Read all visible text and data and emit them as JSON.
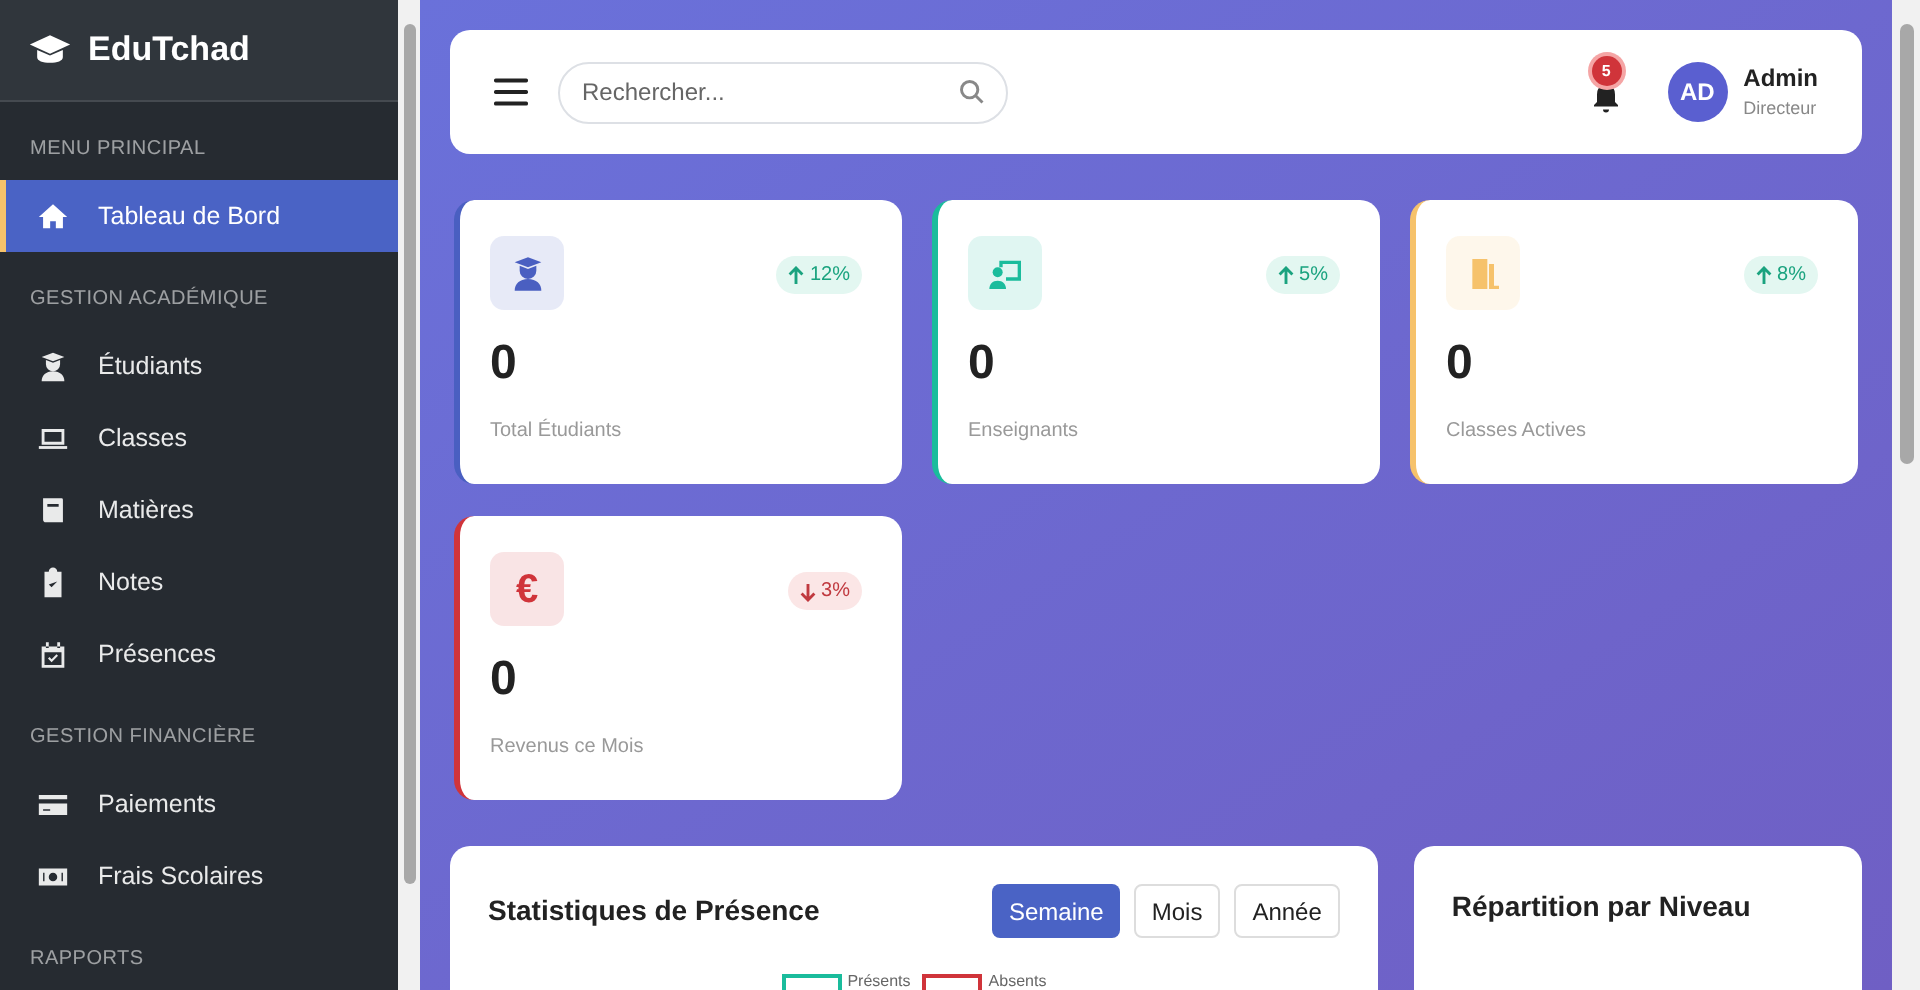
{
  "brand": "EduTchad",
  "sidebar": {
    "sections": [
      {
        "title": "MENU PRINCIPAL",
        "items": [
          {
            "label": "Tableau de Bord",
            "selected": true
          }
        ]
      },
      {
        "title": "GESTION ACADÉMIQUE",
        "items": [
          {
            "label": "Étudiants",
            "selected": false
          },
          {
            "label": "Classes",
            "selected": false
          },
          {
            "label": "Matières",
            "selected": false
          },
          {
            "label": "Notes",
            "selected": false
          },
          {
            "label": "Présences",
            "selected": false
          }
        ]
      },
      {
        "title": "GESTION FINANCIÈRE",
        "items": [
          {
            "label": "Paiements",
            "selected": false
          },
          {
            "label": "Frais Scolaires",
            "selected": false
          }
        ]
      },
      {
        "title": "RAPPORTS"
      }
    ]
  },
  "topbar": {
    "search": {
      "placeholder": "Rechercher..."
    },
    "notifications": "5",
    "user": {
      "initials": "AD",
      "name": "Admin",
      "role": "Directeur"
    }
  },
  "stats": [
    {
      "value": "0",
      "label": "Total Étudiants",
      "color": "#4a5fc1",
      "rising": true,
      "change": "12%"
    },
    {
      "value": "0",
      "label": "Enseignants",
      "color": "#1abc9c",
      "rising": true,
      "change": "5%"
    },
    {
      "value": "0",
      "label": "Classes Actives",
      "color": "#f6c26b",
      "rising": true,
      "change": "8%"
    },
    {
      "value": "0",
      "label": "Revenus ce Mois",
      "symbol": "€",
      "color": "#d0343a",
      "rising": false,
      "change": "3%"
    }
  ],
  "attendance": {
    "title": "Statistiques de Présence",
    "periods": [
      {
        "label": "Semaine",
        "selected": true
      },
      {
        "label": "Mois",
        "selected": false
      },
      {
        "label": "Année",
        "selected": false
      }
    ],
    "legend": [
      {
        "label": "Présents",
        "color": "#1abc9c"
      },
      {
        "label": "Absents",
        "color": "#d0343a"
      }
    ]
  },
  "levels": {
    "title": "Répartition par Niveau"
  }
}
